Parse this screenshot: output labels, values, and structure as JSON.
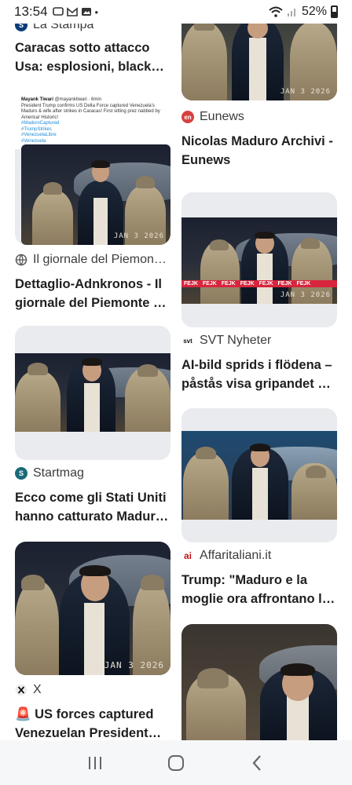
{
  "status_bar": {
    "time": "13:54",
    "battery": "52%"
  },
  "left_column": [
    {
      "source": "La Stampa",
      "title_lines": [
        "Caracas sotto attacco",
        "Usa: esplosioni, blackou…"
      ]
    },
    {
      "tweet": {
        "author": "Mayank Tiwari",
        "handle": "@mayanktiwari · 6min",
        "text": "President Trump confirms US Delta Force captured Venezuela's Maduro & wife after strikes in Caracas! First sitting prez nabbed by America! Historic!",
        "tags": [
          "#MaduroCaptured",
          "#TrumpStrikes",
          "#VenezuelaLibre",
          "#Venezuela"
        ]
      },
      "photo_stamp": "JAN 3 2026",
      "source": "Il giornale del Piemon…",
      "title_lines": [
        "Dettaglio-Adnkronos - Il",
        "giornale del Piemonte e…"
      ]
    },
    {
      "source": "Startmag",
      "title_lines": [
        "Ecco come gli Stati Uniti",
        "hanno catturato Maduro …"
      ]
    },
    {
      "photo_stamp": "JAN 3 2026",
      "source": "X",
      "title_lines": [
        "🚨 US forces captured",
        "Venezuelan President…"
      ]
    }
  ],
  "right_column": [
    {
      "photo_stamp": "JAN 3 2026",
      "source": "Eunews",
      "title_lines": [
        "Nicolas Maduro Archivi -",
        "Eunews"
      ]
    },
    {
      "photo_stamp": "JAN 3 2026",
      "fejk_label": "FEJK",
      "source": "SVT Nyheter",
      "title_lines": [
        "AI-bild sprids i flödena –",
        "påstås visa gripandet –…"
      ]
    },
    {
      "source": "Affaritaliani.it",
      "title_lines": [
        "Trump: \"Maduro e la",
        "moglie ora affrontano la…"
      ]
    },
    {
      "photo_stamp": ""
    }
  ],
  "nav": {
    "recents": "recent-apps",
    "home": "home",
    "back": "back"
  }
}
